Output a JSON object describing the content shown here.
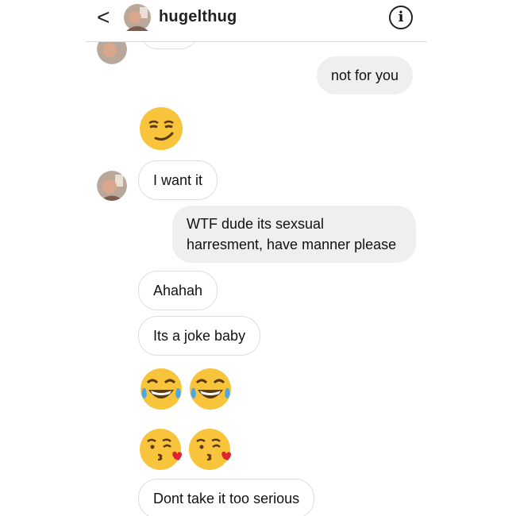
{
  "header": {
    "back_glyph": "<",
    "username": "hugelthug",
    "info_glyph": "i"
  },
  "messages": {
    "m1": "not for you",
    "m2": "I want it",
    "m3_line1": "WTF dude its sexsual",
    "m3_line2": "harresment, have manner please",
    "m4": "Ahahah",
    "m5": "Its a joke baby",
    "m6": "Dont take it too serious"
  },
  "emojis": [
    "smirk-emoji",
    "joy-emoji",
    "joy-emoji",
    "kissing-heart-emoji",
    "kissing-heart-emoji"
  ],
  "colors": {
    "incoming_border": "#dedede",
    "outgoing_bg": "#efefef",
    "emoji_yellow": "#f7c43c",
    "heart": "#e0212f"
  }
}
